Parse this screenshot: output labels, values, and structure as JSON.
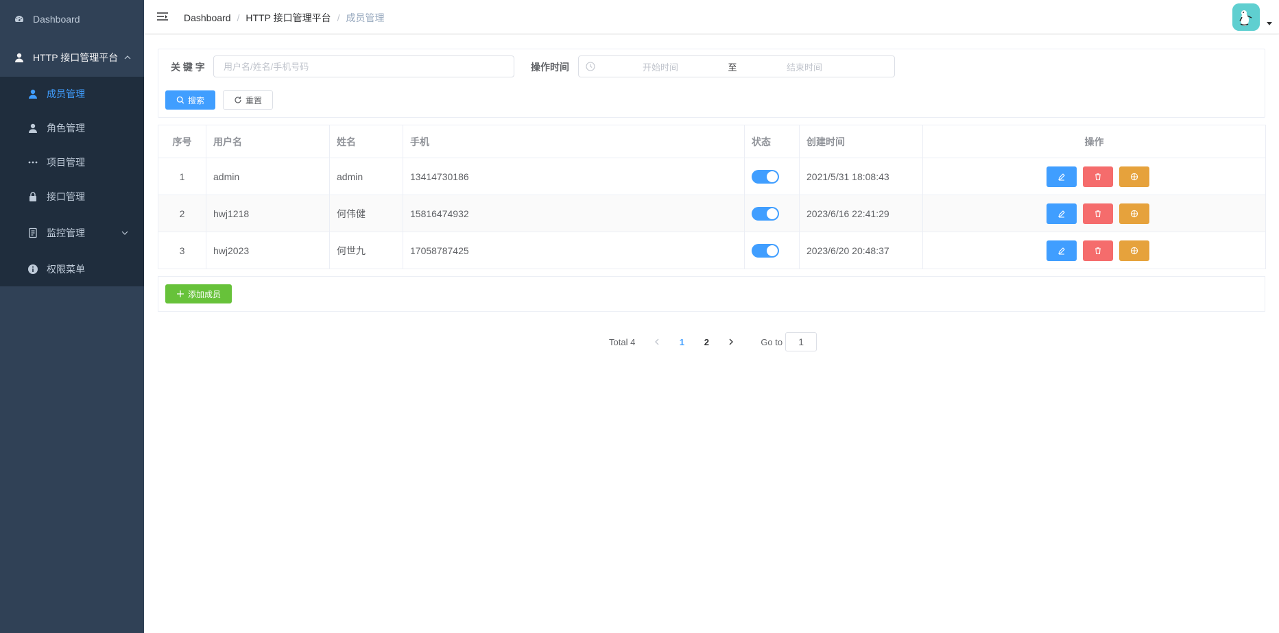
{
  "sidebar": {
    "dashboard": "Dashboard",
    "platform": "HTTP 接口管理平台",
    "items": [
      {
        "label": "成员管理"
      },
      {
        "label": "角色管理"
      },
      {
        "label": "项目管理"
      },
      {
        "label": "接口管理"
      },
      {
        "label": "监控管理"
      },
      {
        "label": "权限菜单"
      }
    ]
  },
  "header": {
    "breadcrumb": [
      "Dashboard",
      "HTTP 接口管理平台",
      "成员管理"
    ]
  },
  "filter": {
    "keyword_label": "关 键 字",
    "keyword_placeholder": "用户名/姓名/手机号码",
    "time_label": "操作时间",
    "start_placeholder": "开始时间",
    "range_sep": "至",
    "end_placeholder": "结束时间",
    "search_label": "搜索",
    "reset_label": "重置"
  },
  "table": {
    "columns": [
      "序号",
      "用户名",
      "姓名",
      "手机",
      "状态",
      "创建时间",
      "操作"
    ],
    "rows": [
      {
        "index": "1",
        "username": "admin",
        "name": "admin",
        "phone": "13414730186",
        "status": true,
        "created": "2021/5/31 18:08:43"
      },
      {
        "index": "2",
        "username": "hwj1218",
        "name": "何伟健",
        "phone": "15816474932",
        "status": true,
        "created": "2023/6/16 22:41:29"
      },
      {
        "index": "3",
        "username": "hwj2023",
        "name": "何世九",
        "phone": "17058787425",
        "status": true,
        "created": "2023/6/20 20:48:37"
      }
    ]
  },
  "add_button": "添加成员",
  "pagination": {
    "total": "Total 4",
    "pages": [
      "1",
      "2"
    ],
    "current": "1",
    "goto_label": "Go to",
    "goto_value": "1"
  },
  "colors": {
    "sidebar_bg": "#304156",
    "submenu_bg": "#1f2d3d",
    "primary": "#409eff",
    "danger": "#f56c6c",
    "warning": "#e6a23c",
    "success": "#67c23a"
  }
}
